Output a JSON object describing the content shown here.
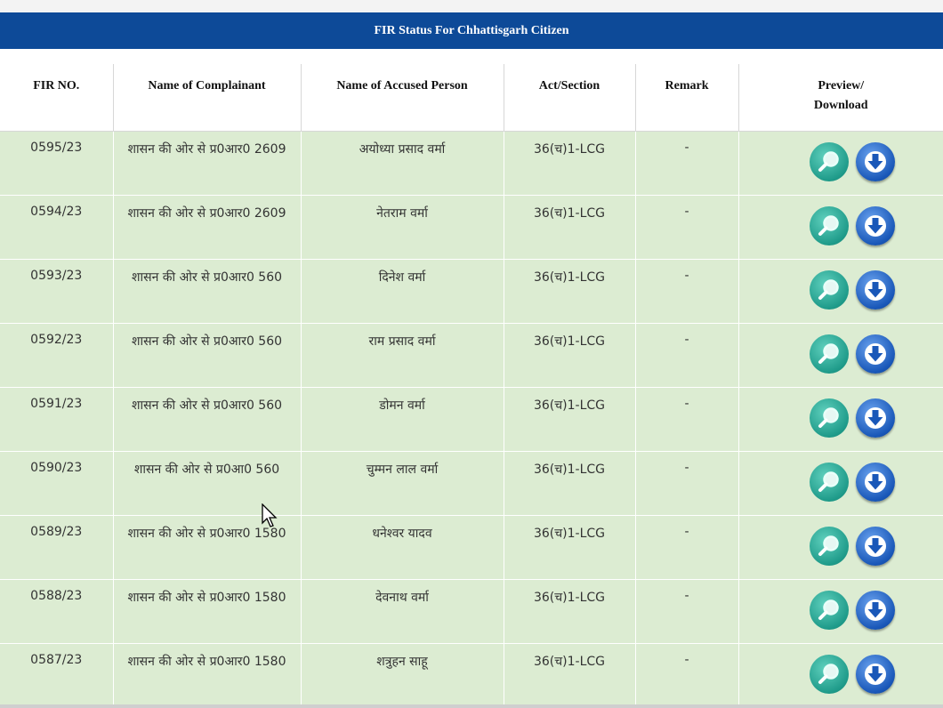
{
  "page": {
    "title": "FIR Status For Chhattisgarh Citizen"
  },
  "table": {
    "headers": {
      "fir_no": "FIR NO.",
      "complainant": "Name of Complainant",
      "accused": "Name of Accused Person",
      "act": "Act/Section",
      "remark": "Remark",
      "preview_line1": "Preview/",
      "preview_line2": "Download"
    },
    "rows": [
      {
        "fir_no": "0595/23",
        "complainant": "शासन की ओर से प्र0आर0 2609",
        "accused": "अयोध्या प्रसाद वर्मा",
        "act": "36(च)1-LCG",
        "remark": "-"
      },
      {
        "fir_no": "0594/23",
        "complainant": "शासन की ओर से प्र0आर0 2609",
        "accused": "नेतराम वर्मा",
        "act": "36(च)1-LCG",
        "remark": "-"
      },
      {
        "fir_no": "0593/23",
        "complainant": "शासन की ओर से प्र0आर0 560",
        "accused": "दिनेश वर्मा",
        "act": "36(च)1-LCG",
        "remark": "-"
      },
      {
        "fir_no": "0592/23",
        "complainant": "शासन की ओर से प्र0आर0 560",
        "accused": "राम प्रसाद वर्मा",
        "act": "36(च)1-LCG",
        "remark": "-"
      },
      {
        "fir_no": "0591/23",
        "complainant": "शासन की ओर से प्र0आर0 560",
        "accused": "डोमन वर्मा",
        "act": "36(च)1-LCG",
        "remark": "-"
      },
      {
        "fir_no": "0590/23",
        "complainant": "शासन की ओर से प्र0आ0 560",
        "accused": "चुम्मन लाल वर्मा",
        "act": "36(च)1-LCG",
        "remark": "-"
      },
      {
        "fir_no": "0589/23",
        "complainant": "शासन की ओर से प्र0आर0 1580",
        "accused": "धनेश्वर यादव",
        "act": "36(च)1-LCG",
        "remark": "-"
      },
      {
        "fir_no": "0588/23",
        "complainant": "शासन की ओर से प्र0आर0 1580",
        "accused": "देवनाथ वर्मा",
        "act": "36(च)1-LCG",
        "remark": "-"
      },
      {
        "fir_no": "0587/23",
        "complainant": "शासन की ओर से प्र0आर0 1580",
        "accused": "शत्रुहन साहू",
        "act": "36(च)1-LCG",
        "remark": "-"
      }
    ]
  },
  "icons": {
    "preview": "magnifier-icon",
    "download": "download-arrow-icon"
  },
  "colors": {
    "header_bar": "#0d4a98",
    "row_bg": "#dcecd2",
    "preview_btn": "#1f9b8a",
    "download_btn": "#1957b8"
  }
}
